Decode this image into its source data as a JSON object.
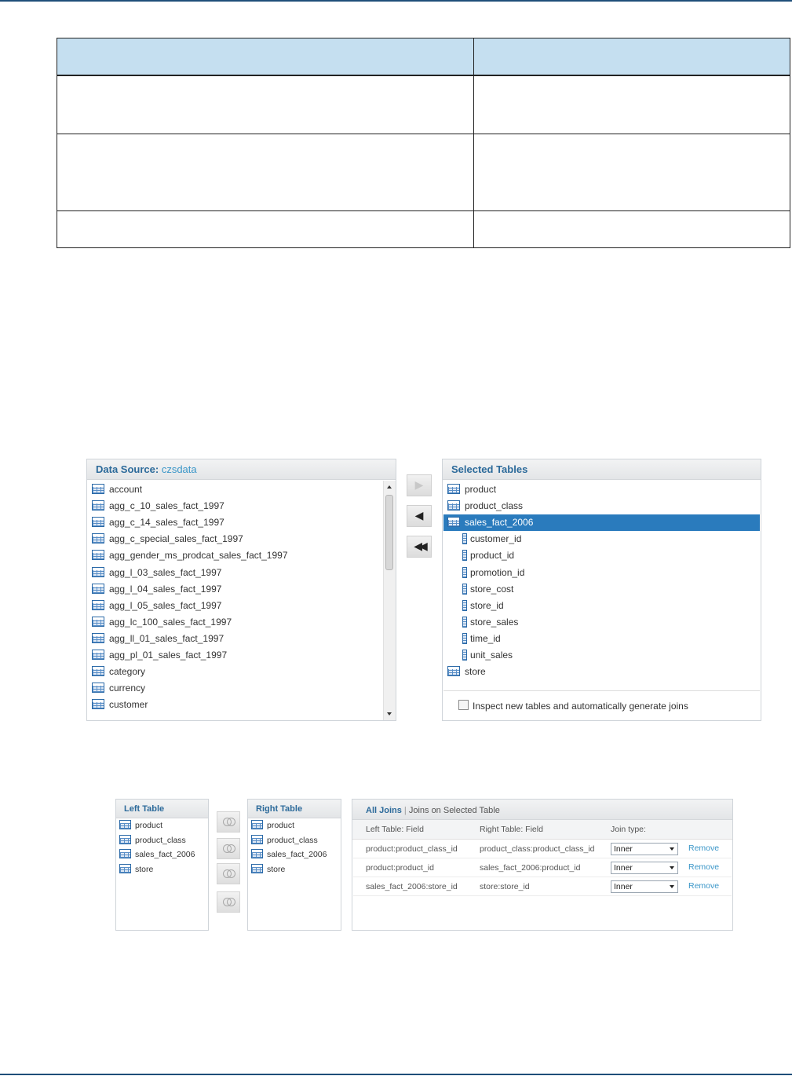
{
  "data_source_panel": {
    "title_label": "Data Source:",
    "source_name": "czsdata",
    "tables": [
      "account",
      "agg_c_10_sales_fact_1997",
      "agg_c_14_sales_fact_1997",
      "agg_c_special_sales_fact_1997",
      "agg_gender_ms_prodcat_sales_fact_1997",
      "agg_l_03_sales_fact_1997",
      "agg_l_04_sales_fact_1997",
      "agg_l_05_sales_fact_1997",
      "agg_lc_100_sales_fact_1997",
      "agg_ll_01_sales_fact_1997",
      "agg_pl_01_sales_fact_1997",
      "category",
      "currency",
      "customer"
    ]
  },
  "move_buttons": {
    "add": "▶",
    "remove": "◀",
    "remove_all": "◀◀"
  },
  "selected_tables_panel": {
    "title": "Selected Tables",
    "tables": [
      "product",
      "product_class",
      "sales_fact_2006",
      "store"
    ],
    "expanded_table": "sales_fact_2006",
    "columns": [
      "customer_id",
      "product_id",
      "promotion_id",
      "store_cost",
      "store_id",
      "store_sales",
      "time_id",
      "unit_sales"
    ],
    "inspect_label": "Inspect new tables and automatically generate joins"
  },
  "left_table_panel": {
    "title": "Left Table",
    "tables": [
      "product",
      "product_class",
      "sales_fact_2006",
      "store"
    ]
  },
  "right_table_panel": {
    "title": "Right Table",
    "tables": [
      "product",
      "product_class",
      "sales_fact_2006",
      "store"
    ]
  },
  "joins_panel": {
    "tab_all": "All Joins",
    "tab_selected": "Joins on Selected Table",
    "col_left": "Left Table: Field",
    "col_right": "Right Table: Field",
    "col_type": "Join type:",
    "remove_label": "Remove",
    "rows": [
      {
        "left": "product:product_class_id",
        "right": "product_class:product_class_id",
        "type": "Inner"
      },
      {
        "left": "product:product_id",
        "right": "sales_fact_2006:product_id",
        "type": "Inner"
      },
      {
        "left": "sales_fact_2006:store_id",
        "right": "store:store_id",
        "type": "Inner"
      }
    ]
  },
  "colors": {
    "accent": "#2c6a9a",
    "link": "#3a96c8",
    "selection": "#2a7bbd",
    "doc_header": "#c5dff0",
    "rule": "#1f4e79"
  }
}
